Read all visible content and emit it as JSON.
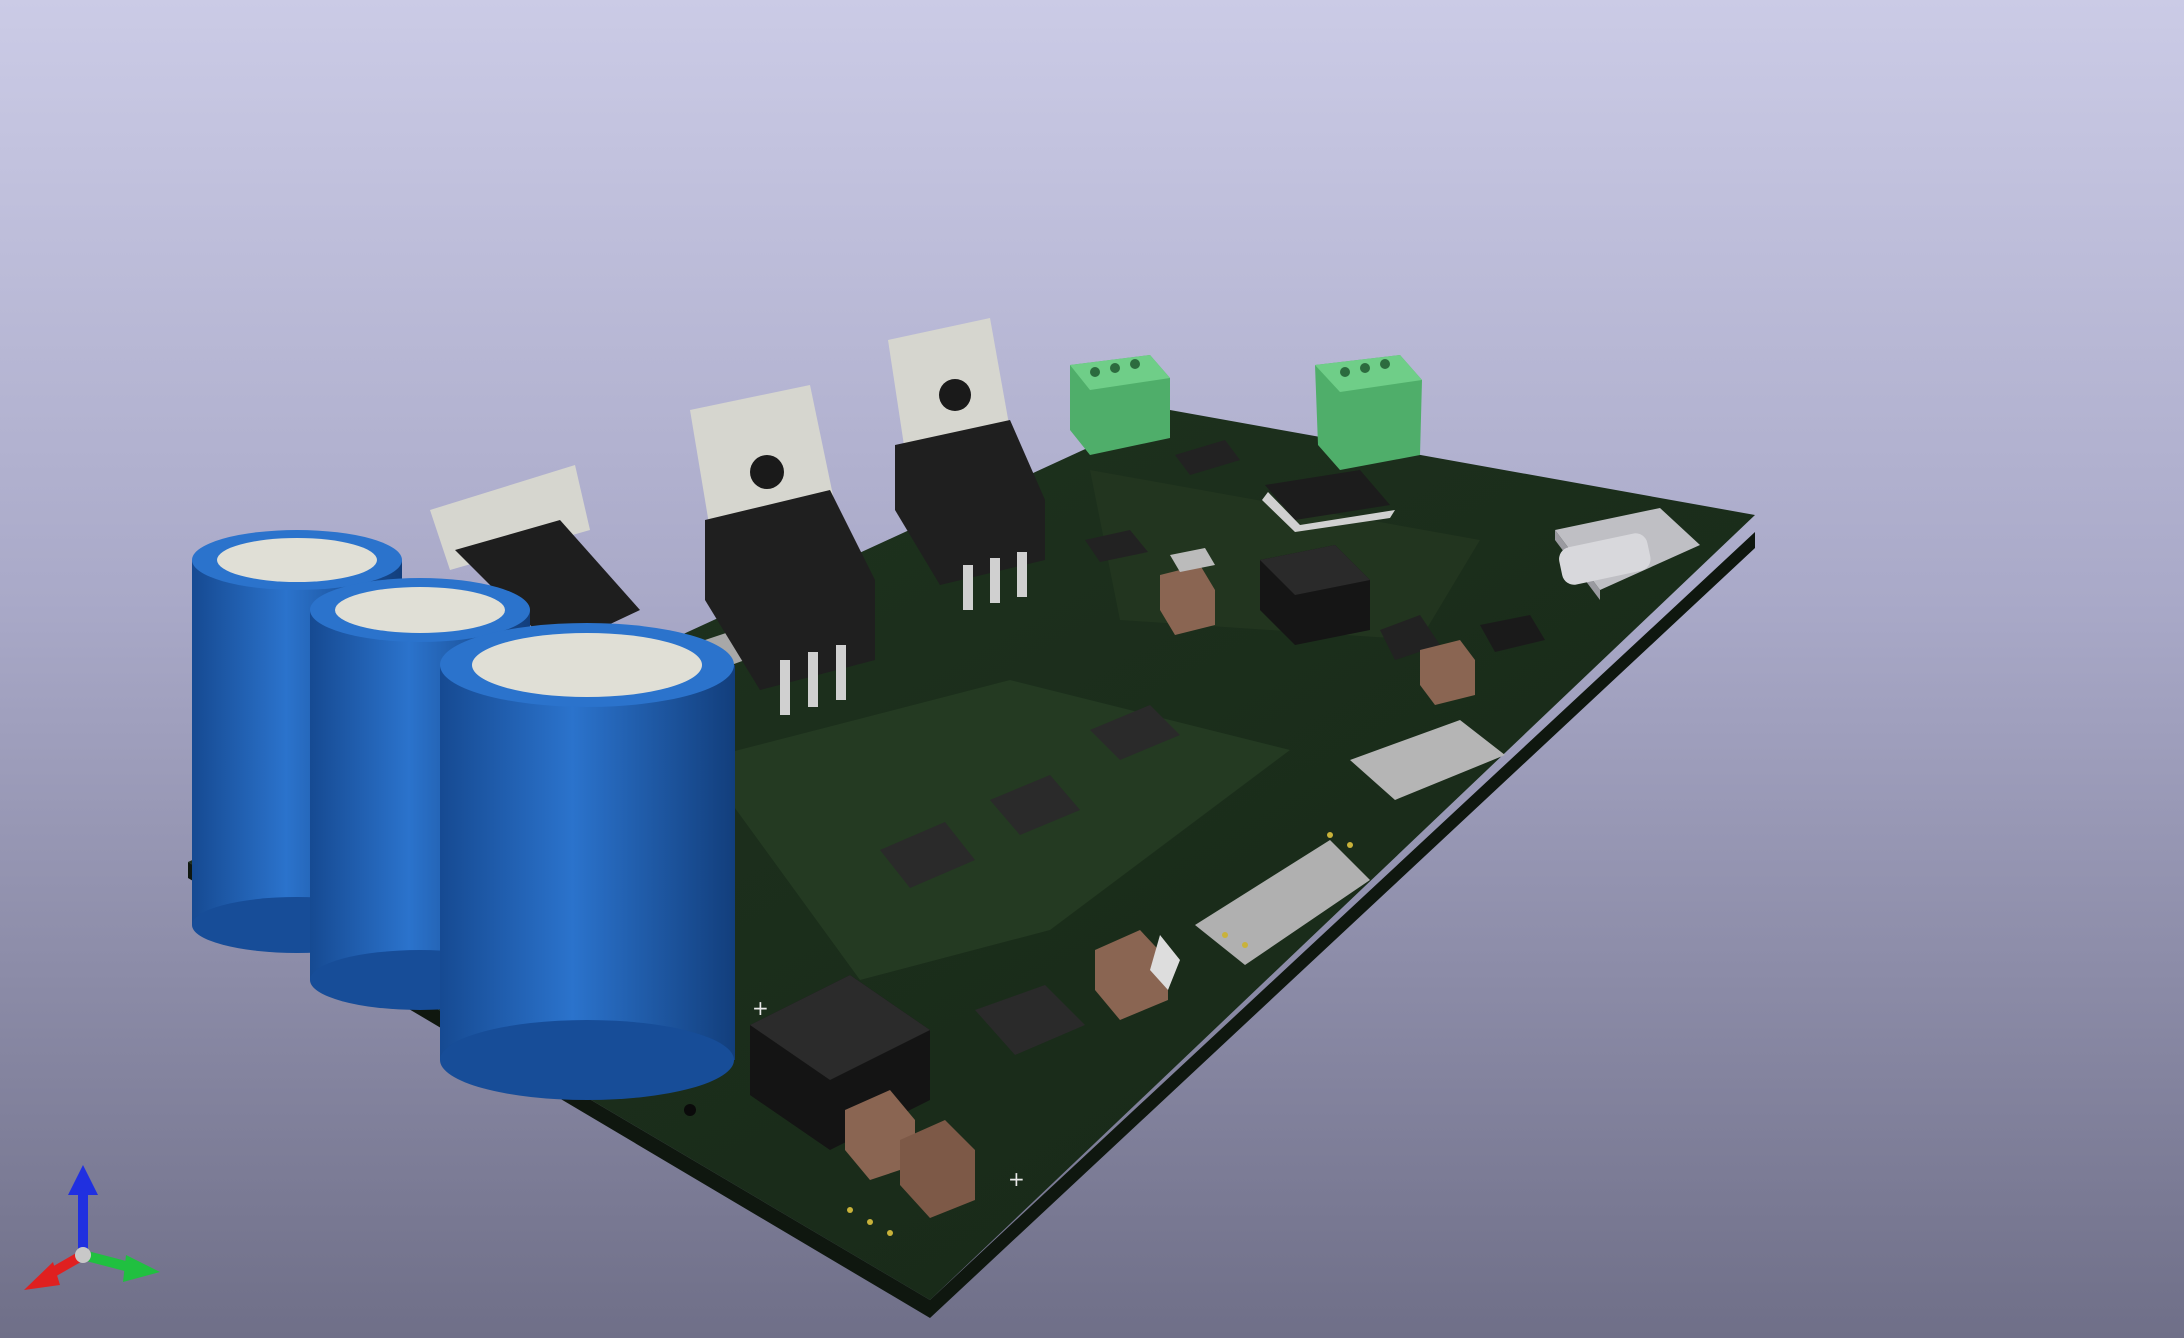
{
  "viewer": {
    "background_top": "#cbcbe6",
    "background_bottom": "#6f6f88"
  },
  "board": {
    "soldermask_color": "#1c2e1c",
    "edge_color": "#101a10",
    "silk_color": "#e8e8e8",
    "pad_color": "#c9b23a"
  },
  "components": {
    "electrolytic_capacitors": {
      "count": 3,
      "color": "#1f5fb4",
      "polarity_marks": [
        "+",
        "+"
      ]
    },
    "to220_transistors": {
      "count": 3,
      "tab_color": "#d6d6cf",
      "body_color": "#1e1e1e"
    },
    "terminal_blocks": {
      "count": 2,
      "color": "#4fae6a"
    },
    "usb_c_connector": {
      "count": 1,
      "color": "#c9c9cc"
    },
    "ceramic_capacitors_color": "#8a6552"
  },
  "axis_indicator": {
    "x_color": "#e02020",
    "y_color": "#20c040",
    "z_color": "#2030e0"
  }
}
